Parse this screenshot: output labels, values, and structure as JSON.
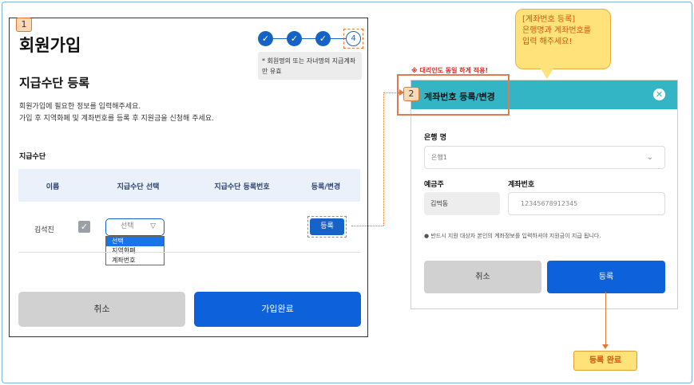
{
  "screen1": {
    "badge": "1",
    "title": "회원가입",
    "steps": [
      "✓",
      "✓",
      "✓",
      "4"
    ],
    "note_line1": "* 회원명의 또는 자녀명의 지급계좌",
    "note_line2": "만 유효",
    "subtitle": "지급수단 등록",
    "desc_line1": "회원가입에 필요한 정보를 입력해주세요.",
    "desc_line2": "가입 후 지역화폐 및 계좌번호를 등록 후 지원금을 신청해 주세요.",
    "section_label": "지급수단",
    "table": {
      "headers": [
        "이름",
        "지급수단 선택",
        "지급수단 등록번호",
        "등록/변경"
      ],
      "row": {
        "name": "김석진",
        "select_value": "선택",
        "button": "등록"
      }
    },
    "dropdown_options": [
      "선택",
      "지역화폐",
      "계좌번호"
    ],
    "cancel": "취소",
    "submit": "가입완료"
  },
  "callout": {
    "line1": "[계좌번호 등록]",
    "line2": "은행명과 계좌번호를",
    "line3": "입력 해주세요!"
  },
  "red_note": "※ 대리인도 동일 하게 적용!",
  "modal": {
    "badge": "2",
    "title": "계좌번호 등록/변경",
    "bank_label": "은행 명",
    "bank_value": "은행1",
    "holder_label": "예금주",
    "holder_value": "김먹동",
    "account_label": "계좌번호",
    "account_placeholder": "12345678912345",
    "notice": "● 반드시 지원 대상자 본인의 계좌정보를 입력하셔야 지원금이 지급 됩니다.",
    "cancel": "취소",
    "submit": "등록"
  },
  "complete_label": "등록 완료",
  "colors": {
    "primary": "#0d62dc",
    "header_teal": "#33b5c5",
    "annotation_orange": "#e0783a",
    "callout_yellow": "#ffe37a"
  }
}
